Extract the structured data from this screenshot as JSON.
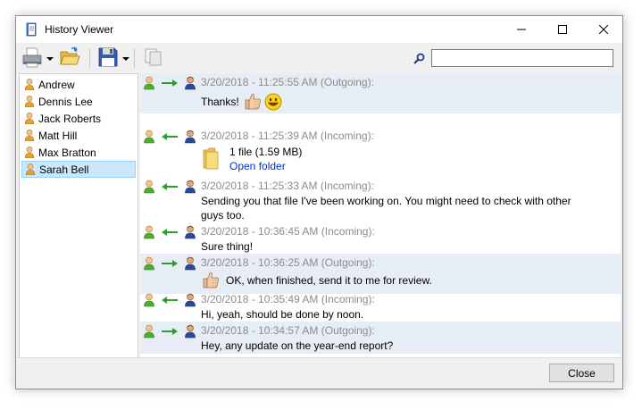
{
  "window": {
    "title": "History Viewer",
    "icon": "history-book-icon"
  },
  "titlebar_buttons": {
    "minimize": "minimize-icon",
    "maximize": "maximize-icon",
    "close": "close-icon"
  },
  "toolbar": {
    "items": [
      "print-icon",
      "dropdown-arrow-icon",
      "open-folder-icon",
      "save-disk-icon",
      "dropdown-arrow-icon",
      "copy-icon"
    ],
    "search": {
      "icon": "search-icon",
      "value": "",
      "placeholder": ""
    }
  },
  "contacts": [
    {
      "name": "Andrew",
      "selected": false
    },
    {
      "name": "Dennis Lee",
      "selected": false
    },
    {
      "name": "Jack Roberts",
      "selected": false
    },
    {
      "name": "Matt Hill",
      "selected": false
    },
    {
      "name": "Max Bratton",
      "selected": false
    },
    {
      "name": "Sarah Bell",
      "selected": true
    }
  ],
  "messages": [
    {
      "direction": "outgoing",
      "timestamp": "3/20/2018 - 11:25:55 AM (Outgoing):",
      "text": "Thanks!",
      "emoticons": [
        "thumbs-up-icon",
        "smiley-icon"
      ]
    },
    {
      "direction": "incoming",
      "timestamp": "3/20/2018 - 11:25:39 AM (Incoming):",
      "file": {
        "label": "1 file (1.59 MB)",
        "link": "Open folder",
        "icon": "folder-icon"
      }
    },
    {
      "direction": "incoming",
      "timestamp": "3/20/2018 - 11:25:33 AM (Incoming):",
      "text_line1": "Sending you that file I've been working on. You might need to check with other",
      "text_line2": "guys too."
    },
    {
      "direction": "incoming",
      "timestamp": "3/20/2018 - 10:36:45 AM (Incoming):",
      "text": "Sure thing!"
    },
    {
      "direction": "outgoing",
      "timestamp": "3/20/2018 - 10:36:25 AM (Outgoing):",
      "text": "OK, when finished, send it to me for review.",
      "emoticons": [
        "thumbs-up-icon"
      ]
    },
    {
      "direction": "incoming",
      "timestamp": "3/20/2018 - 10:35:49 AM (Incoming):",
      "text": "Hi, yeah, should be done by noon."
    },
    {
      "direction": "outgoing",
      "timestamp": "3/20/2018 - 10:34:57 AM (Outgoing):",
      "text": "Hey, any update on the year-end report?"
    }
  ],
  "footer": {
    "close_label": "Close"
  },
  "colors": {
    "outgoing_row": "#e6edf4",
    "selected_contact": "#cce8ff",
    "timestamp": "#8c8c8c",
    "link": "#0033cc",
    "arrow": "#2e9e2e"
  }
}
